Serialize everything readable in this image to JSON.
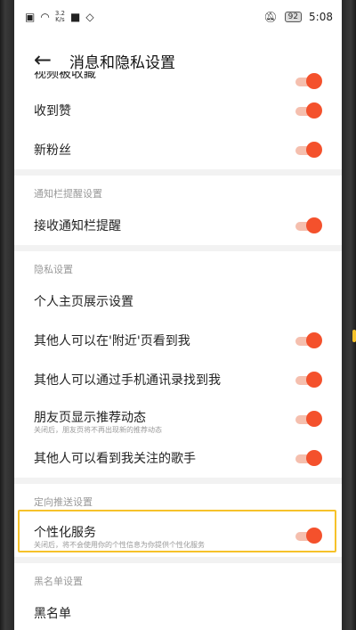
{
  "status_bar": {
    "speed_value": "3.2",
    "speed_unit": "K/s",
    "battery": "92",
    "time": "5:08"
  },
  "header": {
    "back_icon": "arrow-left-icon",
    "title": "消息和隐私设置"
  },
  "rows": {
    "partial_top": "视频被收藏",
    "likes": "收到赞",
    "new_fans": "新粉丝",
    "section_notification": "通知栏提醒设置",
    "notification_bar": "接收通知栏提醒",
    "section_privacy": "隐私设置",
    "homepage_display": "个人主页展示设置",
    "nearby": "其他人可以在'附近'页看到我",
    "contacts": "其他人可以通过手机通讯录找到我",
    "moments": "朋友页显示推荐动态",
    "moments_sub": "关闭后，朋友页将不再出现新的推荐动态",
    "following_singers": "其他人可以看到我关注的歌手",
    "section_targeted": "定向推送设置",
    "personalized": "个性化服务",
    "personalized_sub": "关闭后，将不会使用你的个性信息为你提供个性化服务",
    "section_blacklist": "黑名单设置",
    "blacklist": "黑名单"
  },
  "colors": {
    "accent": "#f4512c",
    "highlight": "#f6c22a"
  }
}
